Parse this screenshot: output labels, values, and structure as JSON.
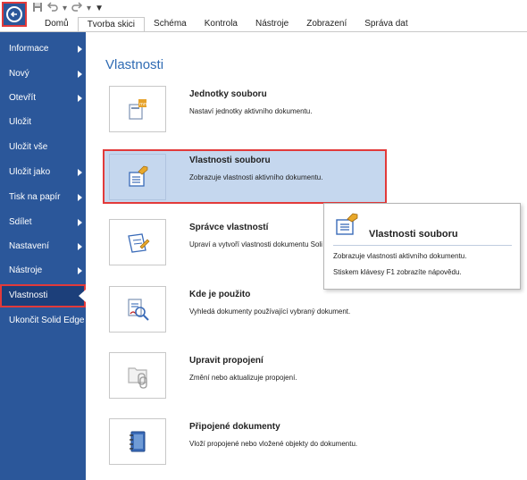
{
  "toolbar": {
    "tabs": [
      "Domů",
      "Tvorba skici",
      "Schéma",
      "Kontrola",
      "Nástroje",
      "Zobrazení",
      "Správa dat"
    ],
    "active_tab_index": 1
  },
  "sidebar": {
    "items": [
      {
        "label": "Informace",
        "has_arrow": true
      },
      {
        "label": "Nový",
        "has_arrow": true
      },
      {
        "label": "Otevřít",
        "has_arrow": true
      },
      {
        "label": "Uložit",
        "has_arrow": false
      },
      {
        "label": "Uložit vše",
        "has_arrow": false
      },
      {
        "label": "Uložit jako",
        "has_arrow": true
      },
      {
        "label": "Tisk na papír",
        "has_arrow": true
      },
      {
        "label": "Sdílet",
        "has_arrow": true
      },
      {
        "label": "Nastavení",
        "has_arrow": true
      },
      {
        "label": "Nástroje",
        "has_arrow": true
      },
      {
        "label": "Vlastnosti",
        "has_arrow": false,
        "active": true
      },
      {
        "label": "Ukončit Solid Edge",
        "has_arrow": false
      }
    ]
  },
  "main": {
    "heading": "Vlastnosti",
    "commands": [
      {
        "title": "Jednotky souboru",
        "desc": "Nastaví jednotky aktivního dokumentu.",
        "icon": "units-icon"
      },
      {
        "title": "Vlastnosti souboru",
        "desc": "Zobrazuje vlastnosti aktivního dokumentu.",
        "icon": "file-properties-icon",
        "selected": true
      },
      {
        "title": "Správce vlastností",
        "desc": "Upraví a vytvoří vlastnosti dokumentu Soli",
        "icon": "property-manager-icon"
      },
      {
        "title": "Kde je použito",
        "desc": "Vyhledá dokumenty používající vybraný dokument.",
        "icon": "where-used-icon"
      },
      {
        "title": "Upravit propojení",
        "desc": "Změní nebo aktualizuje propojení.",
        "icon": "edit-links-icon"
      },
      {
        "title": "Připojené dokumenty",
        "desc": "Vloží propojené nebo vložené objekty do dokumentu.",
        "icon": "attached-documents-icon"
      }
    ]
  },
  "tooltip": {
    "title": "Vlastnosti souboru",
    "desc": "Zobrazuje vlastnosti aktivního dokumentu.",
    "help": "Stiskem klávesy F1 zobrazíte nápovědu."
  },
  "colors": {
    "sidebar": "#2b579a",
    "accent": "#2f6bb3",
    "highlight_border": "#e23a3a",
    "selected_bg": "#c5d7ee"
  }
}
